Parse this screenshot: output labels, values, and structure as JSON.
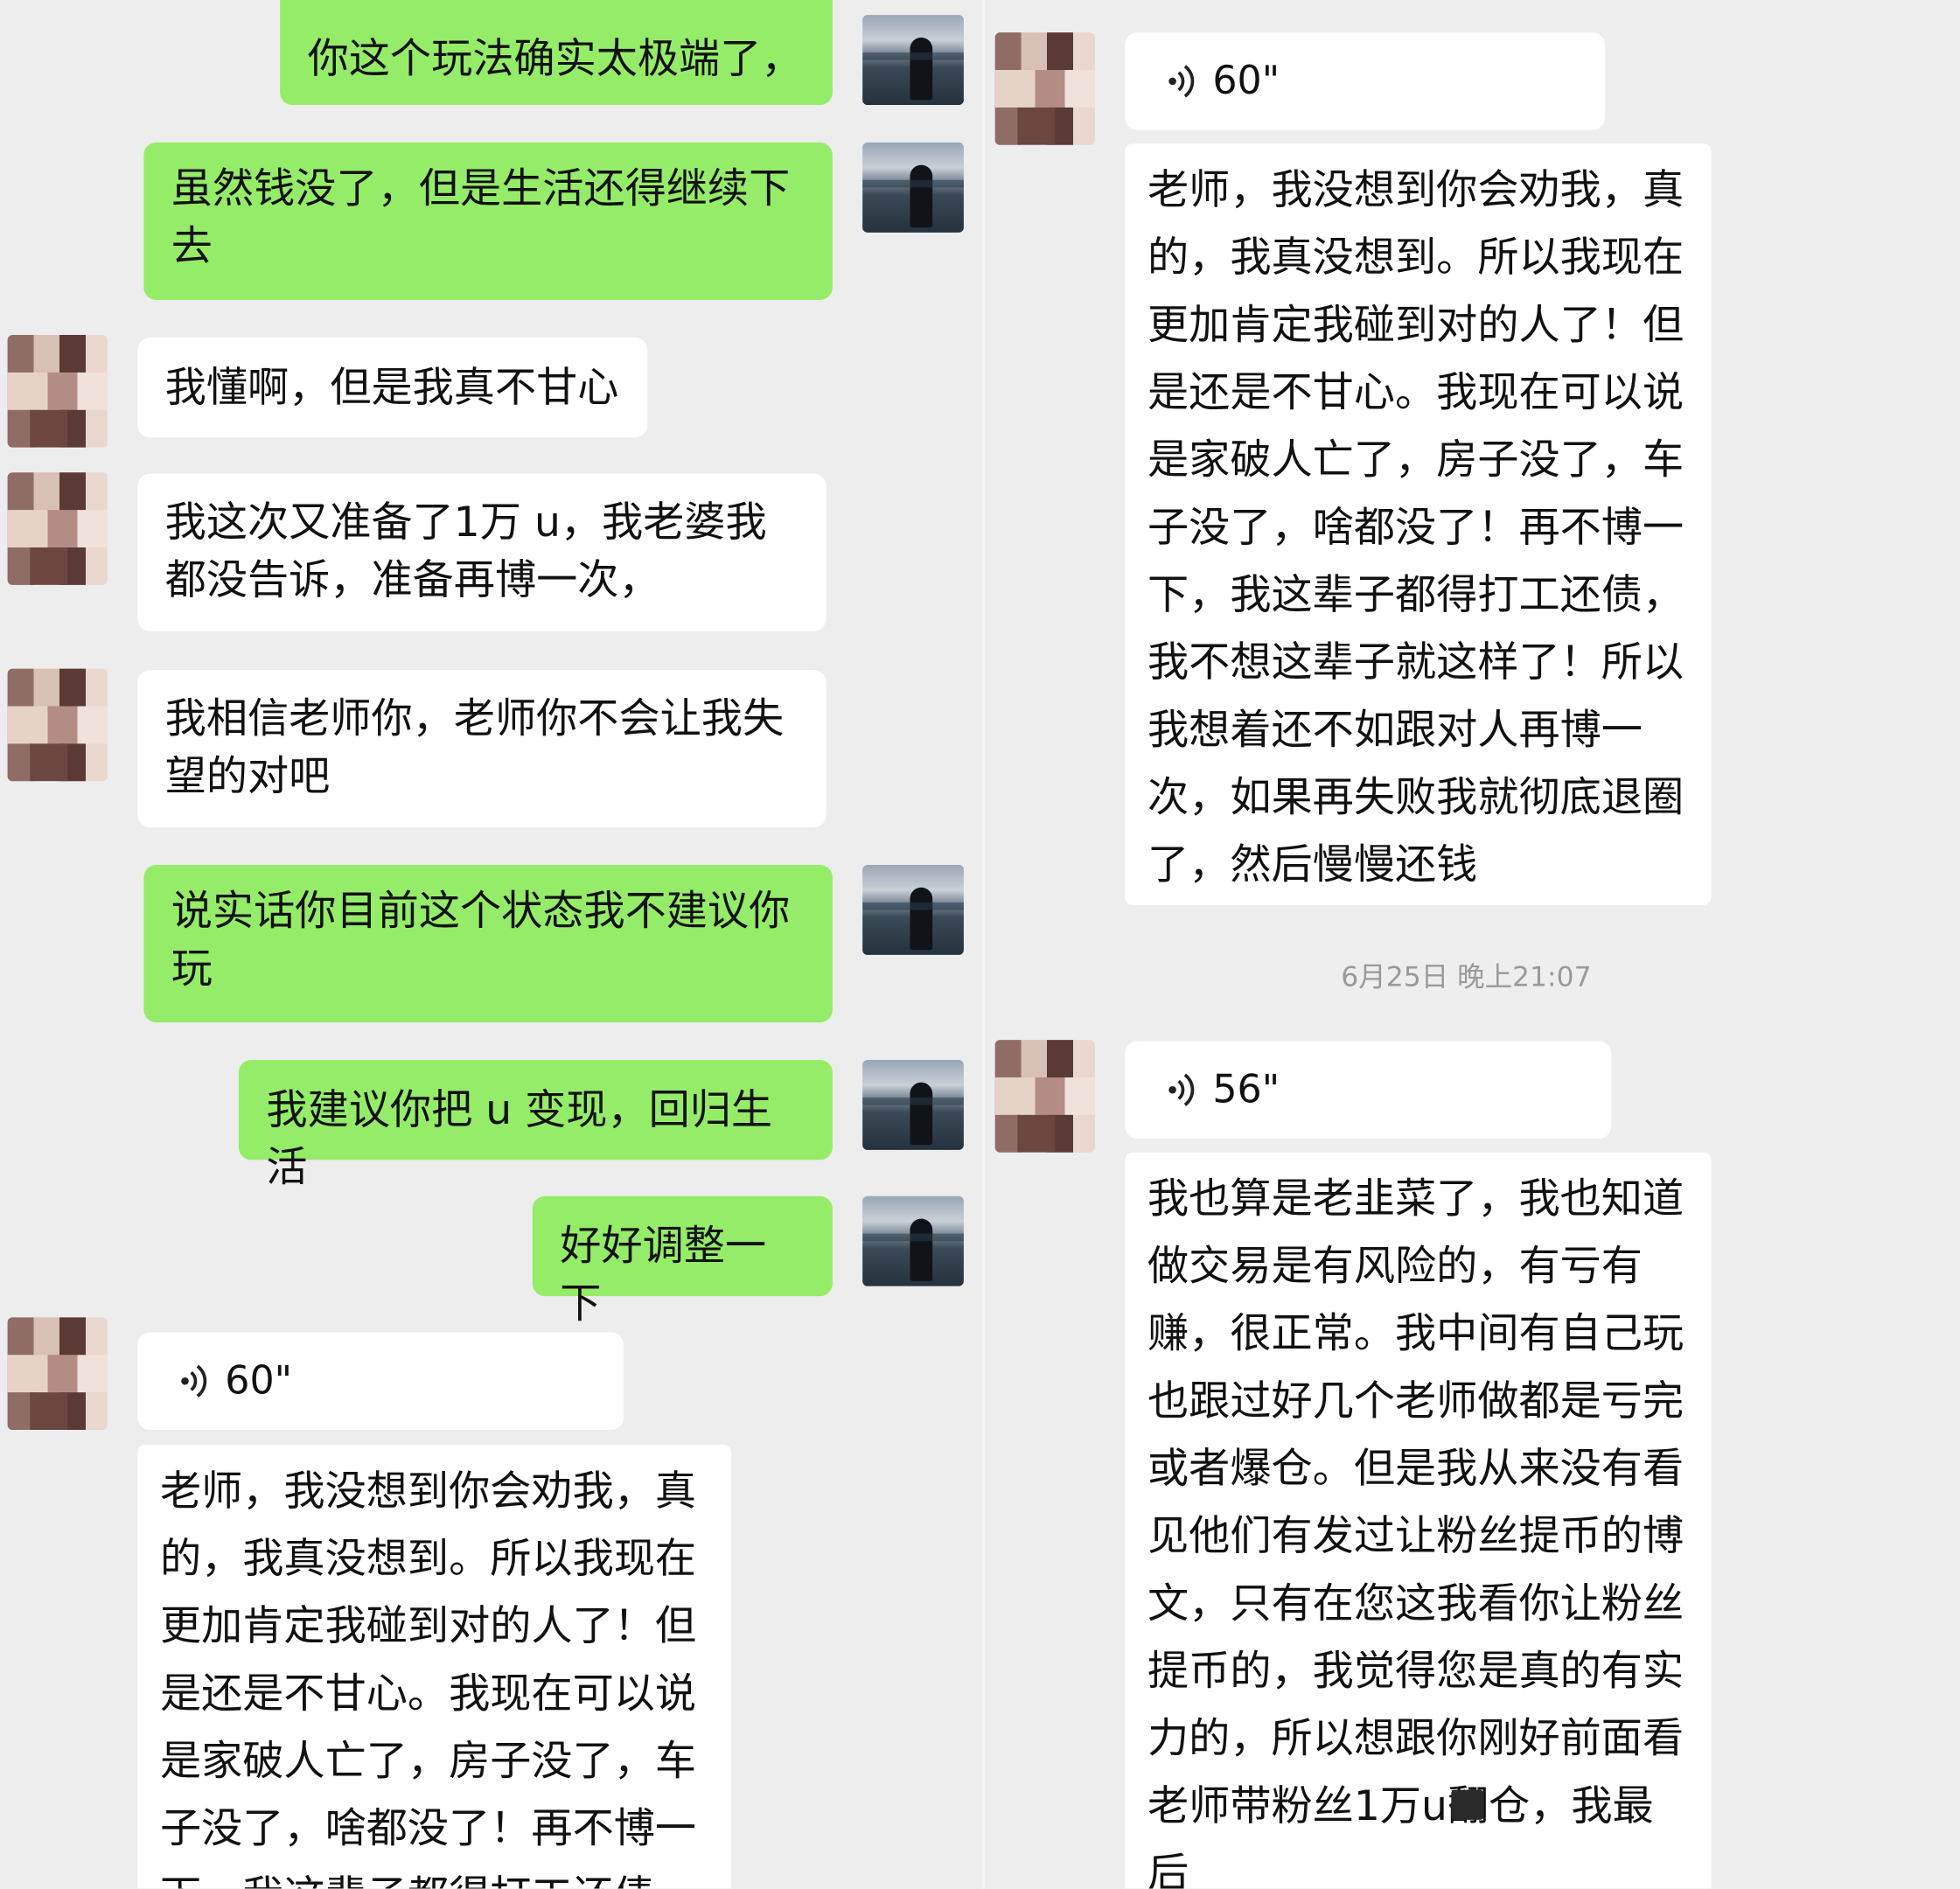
{
  "colors": {
    "background": "#ededed",
    "sent_bubble": "#95ec69",
    "received_bubble": "#ffffff",
    "timestamp_text": "#9a9a9a"
  },
  "left_pane": {
    "messages": [
      {
        "sender": "me",
        "text": "你这个玩法确实太极端了，"
      },
      {
        "sender": "me",
        "text": "虽然钱没了，但是生活还得继续下\n去"
      },
      {
        "sender": "other",
        "text": "我懂啊，但是我真不甘心"
      },
      {
        "sender": "other",
        "text": "我这次又准备了1万 u，我老婆我\n都没告诉，准备再博一次，"
      },
      {
        "sender": "other",
        "text": "我相信老师你，老师你不会让我失\n望的对吧"
      },
      {
        "sender": "me",
        "text": "说实话你目前这个状态我不建议你\n玩"
      },
      {
        "sender": "me",
        "text": "我建议你把 u 变现，回归生活"
      },
      {
        "sender": "me",
        "text": "好好调整一下"
      }
    ],
    "voice": {
      "duration": "60\"",
      "icon": "voice-wave-icon",
      "transcript": "老师，我没想到你会劝我，真\n的，我真没想到。所以我现在\n更加肯定我碰到对的人了！但\n是还是不甘心。我现在可以说\n是家破人亡了，房子没了，车\n子没了，啥都没了！再不博一\n下，我这辈子都得打工还债，"
    }
  },
  "right_pane": {
    "voice_1": {
      "duration": "60\"",
      "icon": "voice-wave-icon",
      "transcript": "老师，我没想到你会劝我，真\n的，我真没想到。所以我现在\n更加肯定我碰到对的人了！但\n是还是不甘心。我现在可以说\n是家破人亡了，房子没了，车\n子没了，啥都没了！再不博一\n下，我这辈子都得打工还债，\n我不想这辈子就这样了！所以\n我想着还不如跟对人再博一\n次，如果再失败我就彻底退圈\n了，然后慢慢还钱"
    },
    "timestamp": "6月25日 晚上21:07",
    "voice_2": {
      "duration": "56\"",
      "icon": "voice-wave-icon",
      "transcript": "我也算是老韭菜了，我也知道\n做交易是有风险的，有亏有\n赚，很正常。我中间有自己玩\n也跟过好几个老师做都是亏完\n或者爆仓。但是我从来没有看\n见他们有发过让粉丝提币的博\n文，只有在您这我看你让粉丝\n提币的，我觉得您是真的有实\n力的，所以想跟你刚好前面看\n老师带粉丝1万u翻仓，我最后\n博一手"
    }
  }
}
